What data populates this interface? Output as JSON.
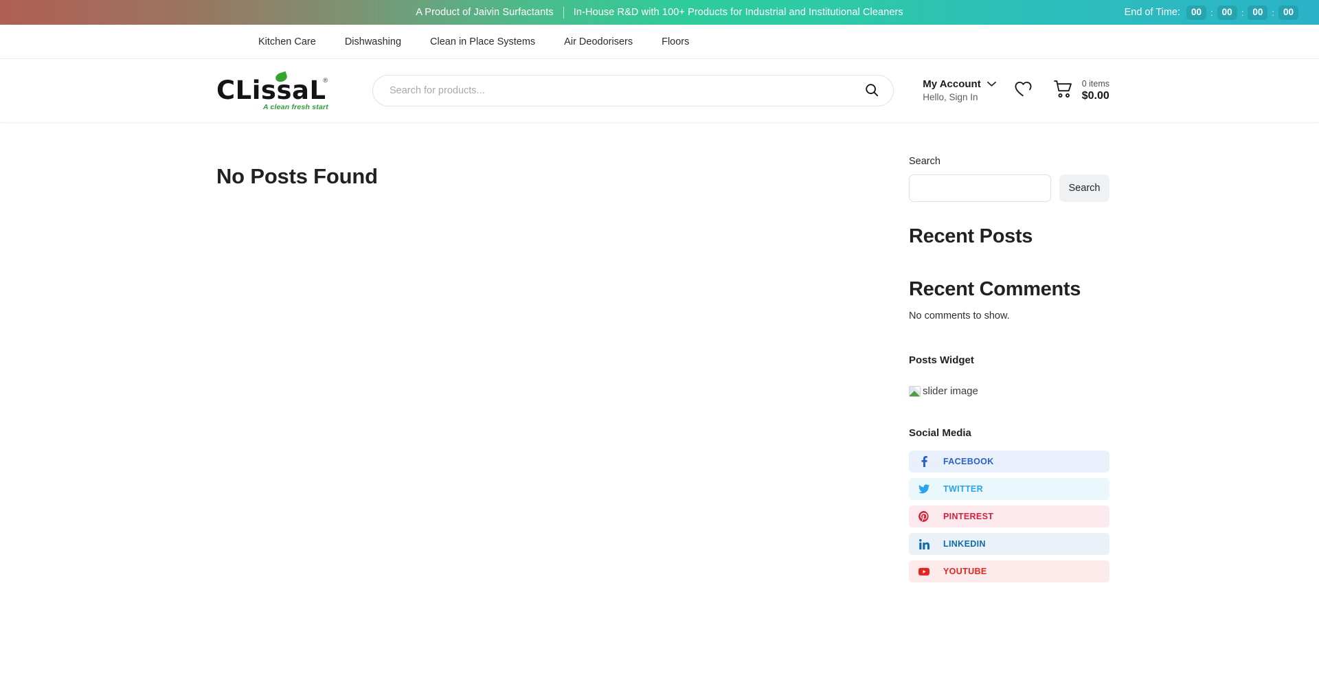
{
  "topbar": {
    "product_line": "A Product of Jaivin Surfactants",
    "tagline": "In-House R&D with 100+ Products for Industrial and Institutional Cleaners",
    "countdown_label": "End of Time:",
    "countdown": [
      "00",
      "00",
      "00",
      "00"
    ],
    "separator": ":",
    "gradient_start": "#b05f55",
    "gradient_mid": "#2ecc9a",
    "gradient_end": "#2bb3c8"
  },
  "nav": {
    "items": [
      {
        "label": "Kitchen Care"
      },
      {
        "label": "Dishwashing"
      },
      {
        "label": "Clean in Place Systems"
      },
      {
        "label": "Air Deodorisers"
      },
      {
        "label": "Floors"
      }
    ]
  },
  "header": {
    "logo": {
      "text_prefix": "CL",
      "text_rest": "issa",
      "text_last": "L",
      "registered": "®",
      "tagline": "A clean fresh start"
    },
    "search": {
      "placeholder": "Search for products...",
      "value": "",
      "icon": "search-icon"
    },
    "account": {
      "title": "My Account",
      "subtitle": "Hello, Sign In",
      "chevron": "chevron-down-icon"
    },
    "wishlist": {
      "icon": "heart-icon"
    },
    "cart": {
      "icon": "cart-icon",
      "items_text": "0 items",
      "total": "$0.00"
    }
  },
  "main": {
    "title": "No Posts Found"
  },
  "sidebar": {
    "search_widget": {
      "label": "Search",
      "input_value": "",
      "input_placeholder": "",
      "button_label": "Search"
    },
    "recent_posts": {
      "title": "Recent Posts"
    },
    "recent_comments": {
      "title": "Recent Comments",
      "empty_text": "No comments to show."
    },
    "posts_widget": {
      "title": "Posts Widget",
      "image_alt": "slider image"
    },
    "social": {
      "title": "Social Media",
      "items": [
        {
          "label": "FACEBOOK",
          "icon": "facebook-icon",
          "color": "#2a61c4",
          "bg": "#eaf0fb"
        },
        {
          "label": "TWITTER",
          "icon": "twitter-icon",
          "color": "#2aa3ef",
          "bg": "#eaf7fd"
        },
        {
          "label": "PINTEREST",
          "icon": "pinterest-icon",
          "color": "#d6203a",
          "bg": "#fdeaee"
        },
        {
          "label": "LINKEDIN",
          "icon": "linkedin-icon",
          "color": "#0f6ba8",
          "bg": "#eaf1f8"
        },
        {
          "label": "YOUTUBE",
          "icon": "youtube-icon",
          "color": "#e52421",
          "bg": "#fdeaea"
        }
      ]
    }
  }
}
